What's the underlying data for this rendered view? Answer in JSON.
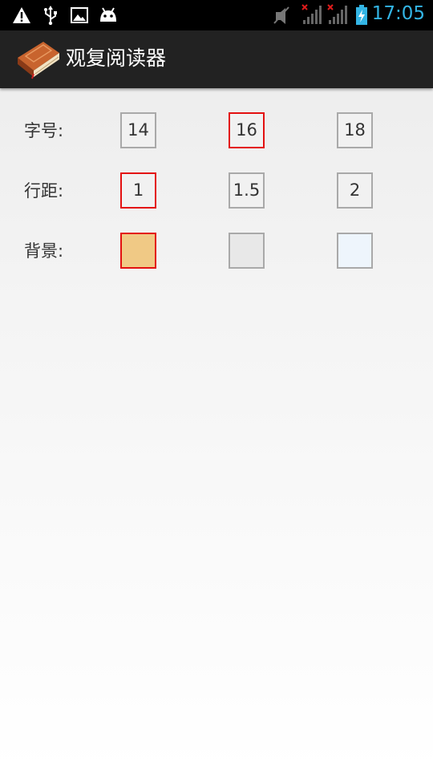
{
  "status_bar": {
    "time": "17:05",
    "icons": [
      "warning-icon",
      "usb-icon",
      "image-icon",
      "android-icon",
      "mute-icon",
      "signal-no-sim-icon",
      "signal-no-sim-icon",
      "battery-charging-icon"
    ]
  },
  "action_bar": {
    "title": "观复阅读器",
    "icon": "book-icon"
  },
  "settings": {
    "font_size": {
      "label": "字号:",
      "options": [
        "14",
        "16",
        "18"
      ],
      "selected": "16"
    },
    "line_spacing": {
      "label": "行距:",
      "options": [
        "1",
        "1.5",
        "2"
      ],
      "selected": "1"
    },
    "background": {
      "label": "背景:",
      "options": [
        "#f0c985",
        "#e8e8e8",
        "#eef5fc"
      ],
      "selected": "#f0c985"
    }
  },
  "colors": {
    "selected_border": "#e31010",
    "default_border": "#a9a9a9",
    "accent": "#33b5e5"
  }
}
